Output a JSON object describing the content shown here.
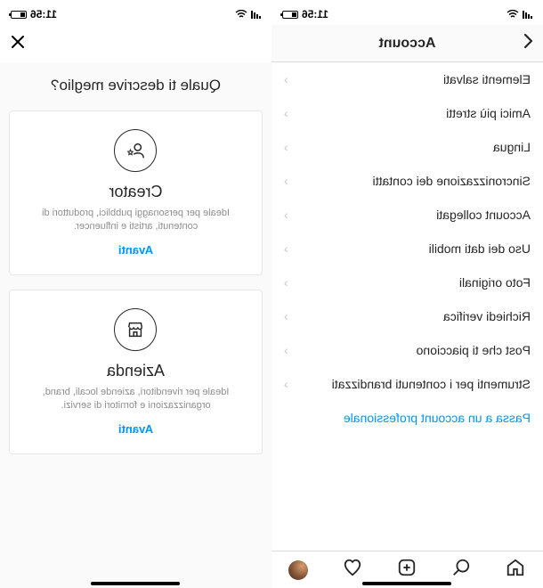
{
  "status": {
    "time": "11:56",
    "wifi_icon": "wifi"
  },
  "left": {
    "header_title": "Account",
    "items": [
      {
        "label": "Elementi salvati"
      },
      {
        "label": "Amici più stretti"
      },
      {
        "label": "Lingua"
      },
      {
        "label": "Sincronizzazione dei contatti"
      },
      {
        "label": "Account collegati"
      },
      {
        "label": "Uso dei dati mobili"
      },
      {
        "label": "Foto originali"
      },
      {
        "label": "Richiedi verifica"
      },
      {
        "label": "Post che ti piacciono"
      },
      {
        "label": "Strumenti per i contenuti brandizzati"
      }
    ],
    "pro_link": "Passa a un account professionale"
  },
  "right": {
    "title": "Quale ti descrive meglio?",
    "options": [
      {
        "icon": "person-star",
        "name": "Creator",
        "desc": "Ideale per personaggi pubblici, produttori di contenuti, artisti e influencer.",
        "cta": "Avanti"
      },
      {
        "icon": "storefront",
        "name": "Azienda",
        "desc": "Ideale per rivenditori, aziende locali, brand, organizzazioni e fornitori di servizi.",
        "cta": "Avanti"
      }
    ]
  }
}
